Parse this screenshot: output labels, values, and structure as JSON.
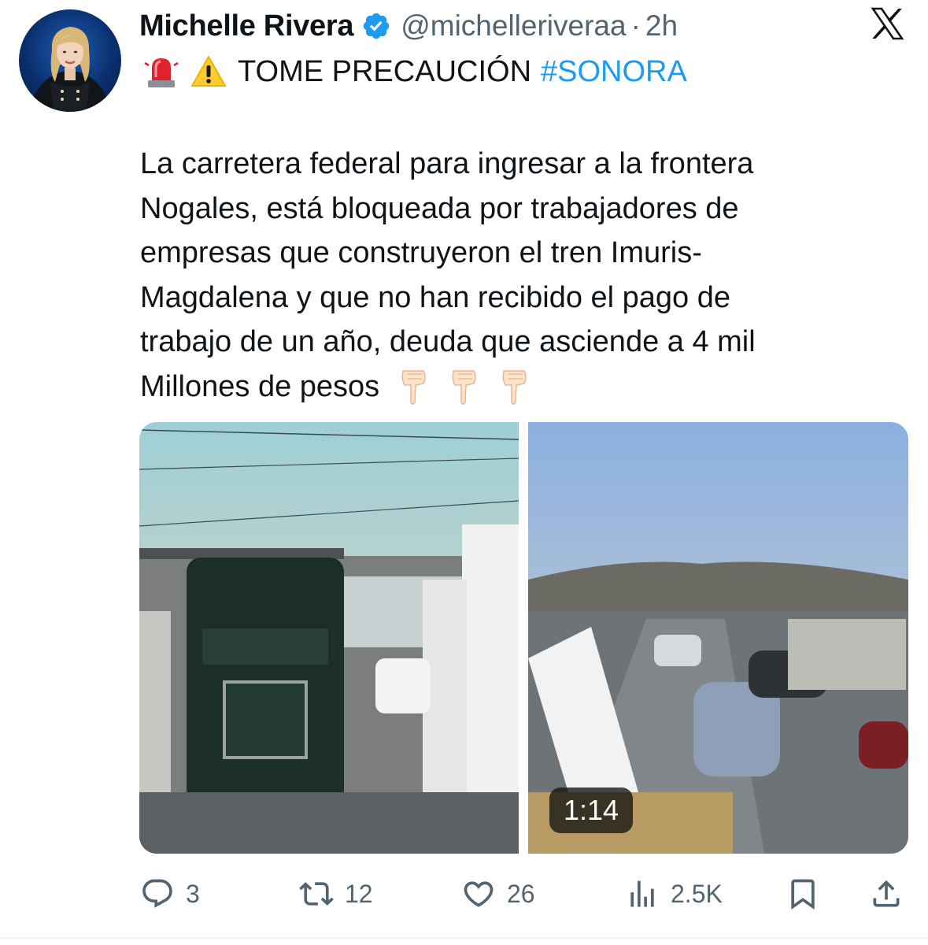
{
  "author": {
    "name": "Michelle Rivera",
    "handle": "@michelleriveraa",
    "separator": "·",
    "time": "2h",
    "verified": true
  },
  "platform_icon": "x-logo-icon",
  "headline": {
    "emoji": [
      "police-light-icon",
      "warning-icon"
    ],
    "text": "TOME PRECAUCIÓN",
    "hashtag": "#SONORA"
  },
  "body": {
    "text": "La carretera federal para ingresar a la frontera\nNogales, está bloqueada por trabajadores de\nempresas que construyeron el tren Imuris-\nMagdalena y que no han recibido el pago de\ntrabajo de un año, deuda que asciende a 4 mil\nMillones de pesos",
    "trailing_emoji": [
      "pointing-down-hand-icon",
      "pointing-down-hand-icon",
      "pointing-down-hand-icon"
    ]
  },
  "media": {
    "items": [
      "video-thumbnail-truck-traffic",
      "video-thumbnail-highway-protest"
    ],
    "video_duration": "1:14"
  },
  "actions": {
    "replies": "3",
    "reposts": "12",
    "likes": "26",
    "views": "2.5K"
  },
  "colors": {
    "accent": "#1d9bf0",
    "text": "#0f1419",
    "secondary": "#536471"
  }
}
